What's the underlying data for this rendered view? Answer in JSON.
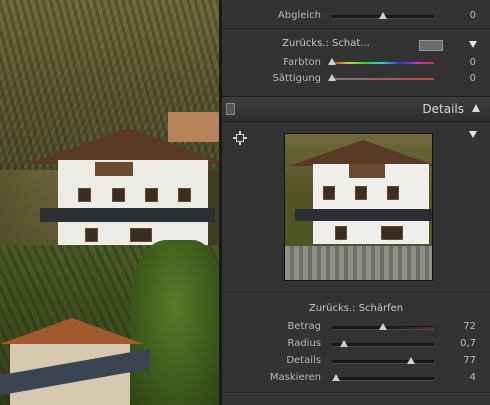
{
  "sections": {
    "top": {
      "abgleich": {
        "label": "Abgleich",
        "value": "0",
        "position": 0.5
      }
    },
    "schatten": {
      "title": "Zurücks.: Schat...",
      "swatch_color": "#6c6c6c",
      "sliders": [
        {
          "label": "Farbton",
          "value": "0",
          "position": 0.0
        },
        {
          "label": "Sättigung",
          "value": "0",
          "position": 0.0
        }
      ]
    },
    "details": {
      "header": "Details",
      "schaerfen_title": "Zurücks.: Schärfen",
      "sliders": [
        {
          "label": "Betrag",
          "value": "72",
          "position": 0.5
        },
        {
          "label": "Radius",
          "value": "0,7",
          "position": 0.12
        },
        {
          "label": "Details",
          "value": "77",
          "position": 0.77
        },
        {
          "label": "Maskieren",
          "value": "4",
          "position": 0.04
        }
      ]
    }
  },
  "icons": {
    "panel_switch": "switch-icon",
    "target": "crosshair-target-icon",
    "collapse": "triangle-down-icon",
    "header_toggle": "triangle-up-icon"
  },
  "colors": {
    "panel_bg": "#333333",
    "slider_thumb": "#cfcfcf",
    "header_text": "#d8d8d8"
  }
}
